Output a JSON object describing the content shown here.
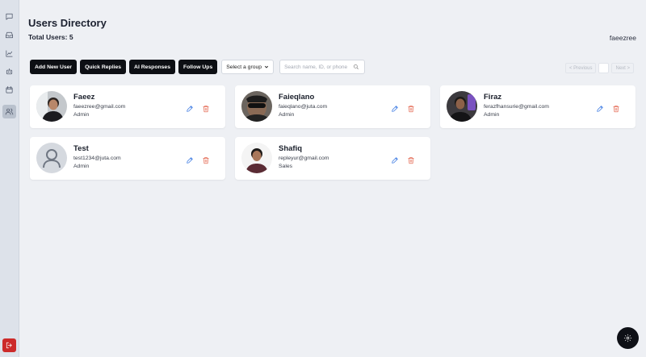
{
  "header": {
    "title": "Users Directory",
    "total_users": "Total Users: 5",
    "current_user": "faeezree"
  },
  "toolbar": {
    "add_new_user": "Add New User",
    "quick_replies": "Quick Replies",
    "ai_responses": "AI Responses",
    "follow_ups": "Follow Ups",
    "group_select": "Select a group",
    "search_placeholder": "Search name, ID, or phone"
  },
  "pagination": {
    "previous": "< Previous",
    "next": "Next >"
  },
  "sidebar": {
    "items": [
      "chat-icon",
      "inbox-icon",
      "chart-icon",
      "bot-icon",
      "calendar-icon",
      "users-icon"
    ],
    "active": "users-icon",
    "logout": "logout-icon"
  },
  "users": [
    {
      "name": "Faeez",
      "email": "faeezree@gmail.com",
      "role": "Admin"
    },
    {
      "name": "Faieqlano",
      "email": "faieqlano@juta.com",
      "role": "Admin"
    },
    {
      "name": "Firaz",
      "email": "ferazfhansurie@gmail.com",
      "role": "Admin"
    },
    {
      "name": "Test",
      "email": "test1234@juta.com",
      "role": "Admin"
    },
    {
      "name": "Shafiq",
      "email": "repleyur@gmail.com",
      "role": "Sales"
    }
  ],
  "colors": {
    "background": "#eef0f4",
    "button_dark": "#0d0f14",
    "edit_blue": "#2b6fe0",
    "delete_red": "#e0533a",
    "logout_red": "#cc2a2a"
  }
}
